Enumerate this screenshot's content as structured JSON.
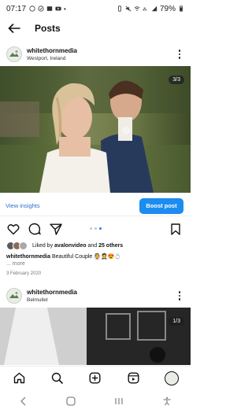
{
  "status_bar": {
    "time": "07:17",
    "battery": "79%"
  },
  "header": {
    "title": "Posts"
  },
  "posts": [
    {
      "username": "whitethornmedia",
      "location": "Westport, Ireland",
      "photo_counter": "3/3",
      "insights_label": "View insights",
      "boost_label": "Boost post",
      "liked_by_prefix": "Liked by ",
      "liked_by_user": "avalonvideo",
      "liked_by_suffix": " and ",
      "liked_by_count": "25 others",
      "caption_user": "whitethornmedia",
      "caption_text": " Beautiful Couple 👰🤵😍💍",
      "more": "... more",
      "date": "3 February 2020",
      "carousel_total": 3,
      "carousel_active": 3
    },
    {
      "username": "whitethornmedia",
      "location": "Belmullet",
      "photo_counter": "1/3"
    }
  ],
  "colors": {
    "accent": "#1d8cf0",
    "link": "#2b6dd6"
  },
  "bottom_nav": [
    "home-icon",
    "search-icon",
    "create-icon",
    "reels-icon",
    "profile-avatar"
  ],
  "system_nav": [
    "back-icon",
    "home-icon",
    "recents-icon",
    "accessibility-icon"
  ]
}
